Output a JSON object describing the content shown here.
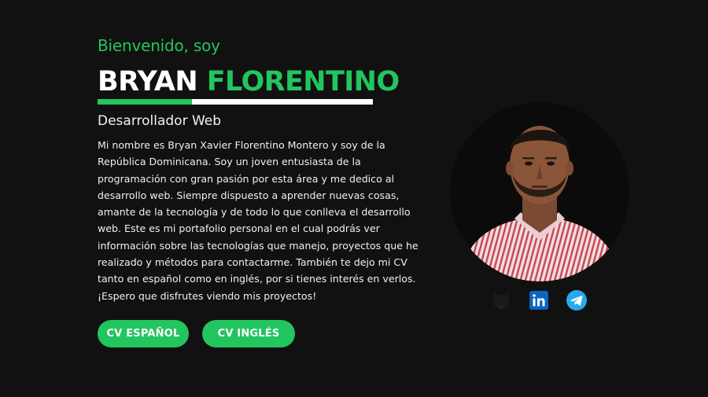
{
  "hero": {
    "greeting": "Bienvenido, soy",
    "first_name": "BRYAN",
    "last_name": "FLORENTINO",
    "role": "Desarrollador Web",
    "bio": "Mi nombre es Bryan Xavier Florentino Montero y soy de la República Dominicana. Soy un joven entusiasta de la programación con gran pasión por esta área y me dedico al desarrollo web. Siempre dispuesto a aprender nuevas cosas, amante de la tecnología y de todo lo que conlleva el desarrollo web. Este es mi portafolio personal en el cual podrás ver información sobre las tecnologías que manejo, proyectos que he realizado y métodos para contactarme. También te dejo mi CV tanto en español como en inglés, por si tienes interés en verlos. ¡Espero que disfrutes viendo mis proyectos!",
    "buttons": {
      "cv_es": "CV ESPAÑOL",
      "cv_en": "CV INGLÉS"
    }
  },
  "social": [
    {
      "icon": "github-icon"
    },
    {
      "icon": "linkedin-icon"
    },
    {
      "icon": "telegram-icon"
    }
  ],
  "colors": {
    "accent": "#22c55e",
    "background": "#111111",
    "linkedin": "#0a66c2",
    "telegram": "#29a9eb"
  }
}
